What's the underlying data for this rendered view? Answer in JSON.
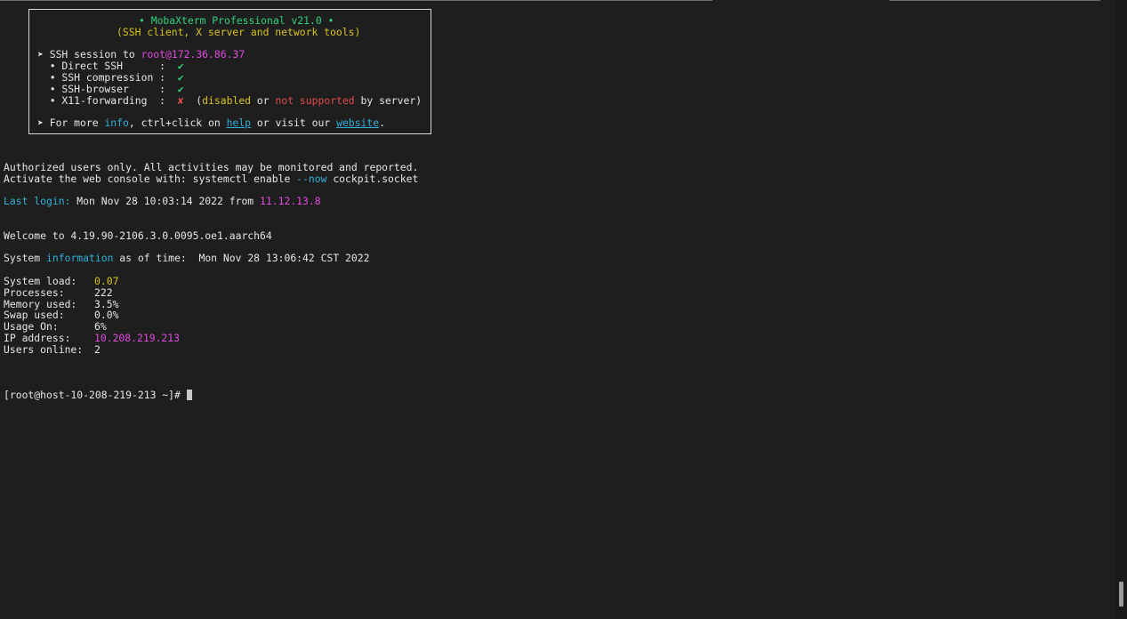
{
  "banner": {
    "title": "• MobaXterm Professional v21.0 •",
    "subtitle": "(SSH client, X server and network tools)",
    "ssh_prefix": "➤ SSH session to ",
    "ssh_target": "root@172.36.86.37",
    "features": [
      {
        "label": "  • Direct SSH      :  ",
        "mark": "✔"
      },
      {
        "label": "  • SSH compression :  ",
        "mark": "✔"
      },
      {
        "label": "  • SSH-browser     :  ",
        "mark": "✔"
      },
      {
        "label": "  • X11-forwarding  :  ",
        "mark": "✘"
      }
    ],
    "x11_note_open": "  (",
    "x11_disabled": "disabled",
    "x11_or": " or ",
    "x11_not_supported": "not supported",
    "x11_by_server": " by server)",
    "more_prefix": "➤ For more ",
    "more_info": "info",
    "more_mid": ", ctrl+click on ",
    "more_help": "help",
    "more_or": " or visit our ",
    "more_website": "website",
    "more_end": "."
  },
  "motd": {
    "authorized": "Authorized users only. All activities may be monitored and reported.",
    "activate_prefix": "Activate the web console with: systemctl enable ",
    "activate_flag": "--now",
    "activate_suffix": " cockpit.socket",
    "last_login_label": "Last login:",
    "last_login_value": " Mon Nov 28 10:03:14 2022 from ",
    "last_login_ip": "11.12.13.8",
    "welcome": "Welcome to 4.19.90-2106.3.0.0095.oe1.aarch64",
    "sysinfo_prefix": "System ",
    "sysinfo_word": "information",
    "sysinfo_suffix": " as of time:  Mon Nov 28 13:06:42 CST 2022"
  },
  "stats": [
    {
      "label": "System load:",
      "value": "0.07",
      "color": "yellow"
    },
    {
      "label": "Processes:",
      "value": "222",
      "color": ""
    },
    {
      "label": "Memory used:",
      "value": "3.5%",
      "color": ""
    },
    {
      "label": "Swap used:",
      "value": "0.0%",
      "color": ""
    },
    {
      "label": "Usage On:",
      "value": "6%",
      "color": ""
    },
    {
      "label": "IP address:",
      "value": "10.208.219.213",
      "color": "magenta"
    },
    {
      "label": "Users online:",
      "value": "2",
      "color": ""
    }
  ],
  "prompt": "[root@host-10-208-219-213 ~]# "
}
